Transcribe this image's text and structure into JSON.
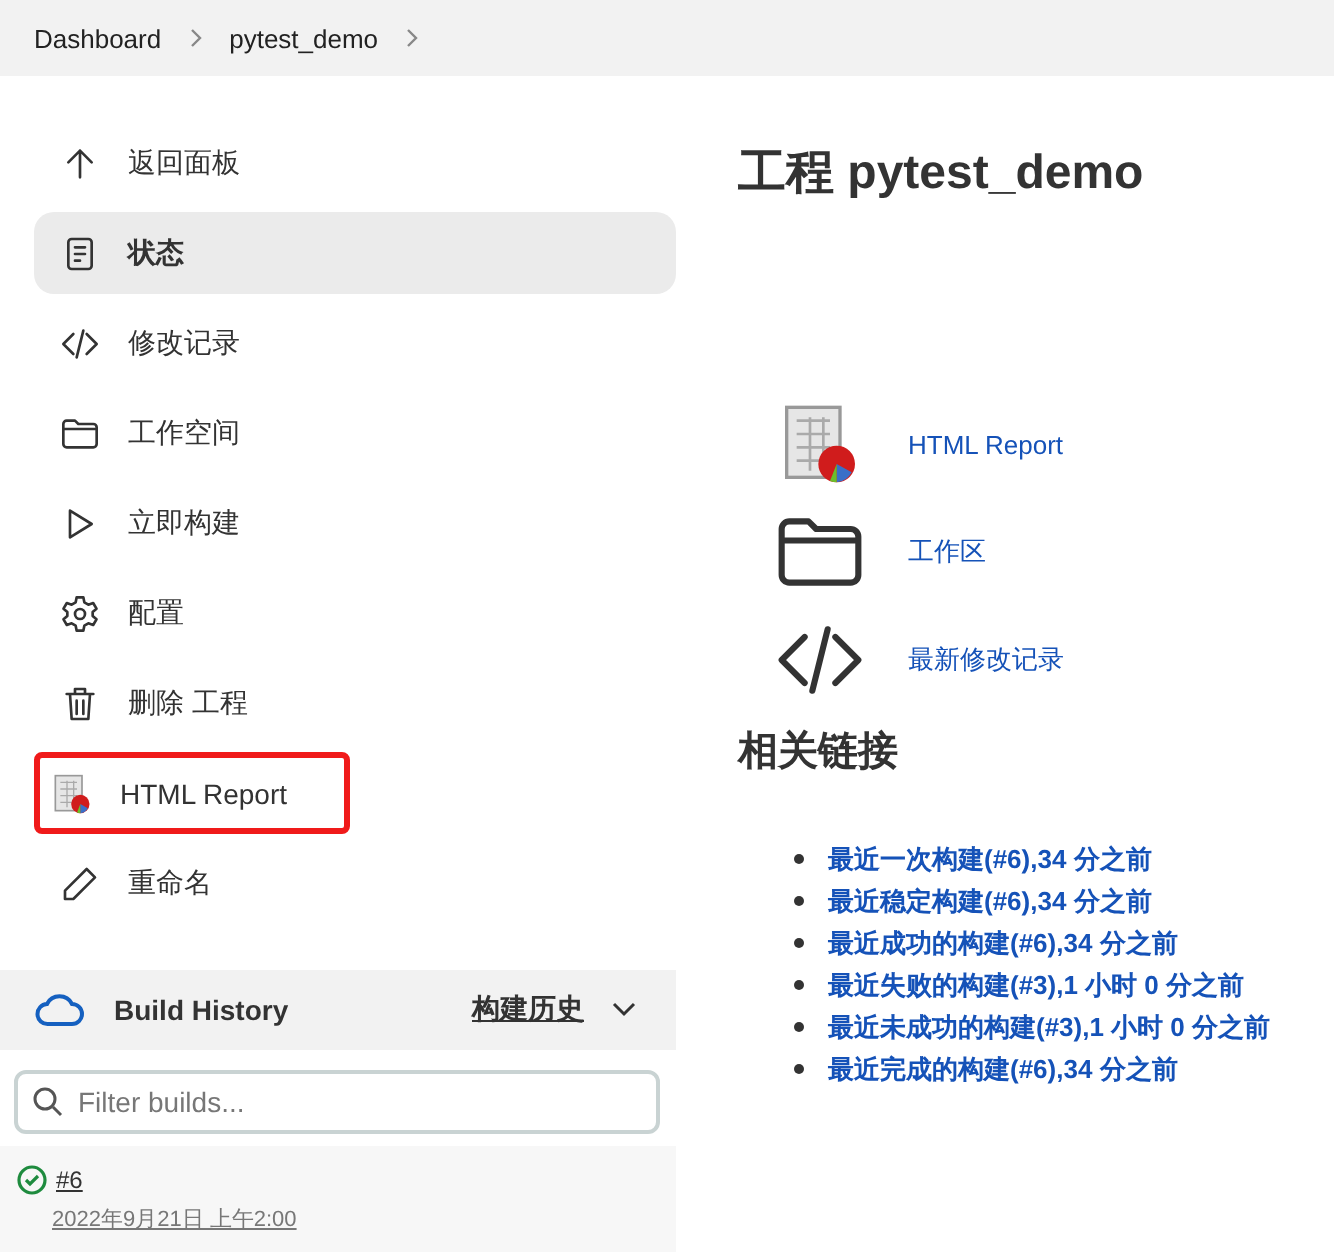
{
  "breadcrumb": [
    {
      "label": "Dashboard"
    },
    {
      "label": "pytest_demo"
    }
  ],
  "sidebar": {
    "items": [
      {
        "kind": "back",
        "label": "返回面板",
        "selected": false,
        "highlighted": false
      },
      {
        "kind": "status",
        "label": "状态",
        "selected": true,
        "highlighted": false
      },
      {
        "kind": "changes",
        "label": "修改记录",
        "selected": false,
        "highlighted": false
      },
      {
        "kind": "workspace",
        "label": "工作空间",
        "selected": false,
        "highlighted": false
      },
      {
        "kind": "build",
        "label": "立即构建",
        "selected": false,
        "highlighted": false
      },
      {
        "kind": "configure",
        "label": "配置",
        "selected": false,
        "highlighted": false
      },
      {
        "kind": "delete",
        "label": "删除 工程",
        "selected": false,
        "highlighted": false
      },
      {
        "kind": "report",
        "label": "HTML Report",
        "selected": false,
        "highlighted": true
      },
      {
        "kind": "rename",
        "label": "重命名",
        "selected": false,
        "highlighted": false
      }
    ]
  },
  "build_history": {
    "title": "Build History",
    "link": "构建历史",
    "filter": {
      "placeholder": "Filter builds..."
    },
    "builds": [
      {
        "number": "#6",
        "date": "2022年9月21日 上午2:00",
        "success": true
      }
    ]
  },
  "main": {
    "title": "工程 pytest_demo",
    "links": [
      {
        "kind": "report",
        "label": "HTML Report"
      },
      {
        "kind": "workspace",
        "label": "工作区"
      },
      {
        "kind": "changes",
        "label": "最新修改记录"
      }
    ],
    "related_heading": "相关链接",
    "related_links": [
      "最近一次构建(#6),34 分之前",
      "最近稳定构建(#6),34 分之前",
      "最近成功的构建(#6),34 分之前",
      "最近失败的构建(#3),1 小时 0 分之前",
      "最近未成功的构建(#3),1 小时 0 分之前",
      "最近完成的构建(#6),34 分之前"
    ]
  }
}
